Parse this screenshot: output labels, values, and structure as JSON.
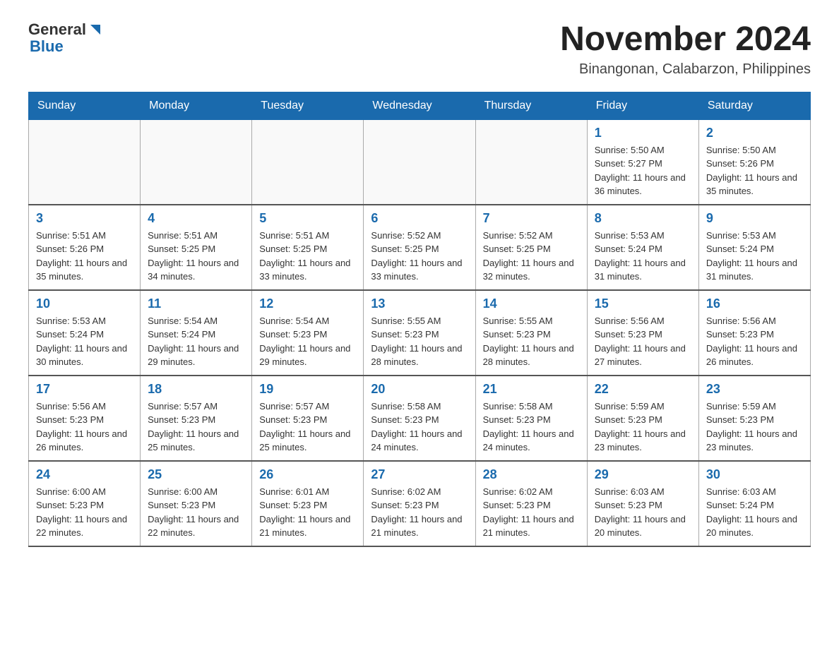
{
  "header": {
    "logo": {
      "general": "General",
      "blue": "Blue"
    },
    "title": "November 2024",
    "subtitle": "Binangonan, Calabarzon, Philippines"
  },
  "weekdays": [
    "Sunday",
    "Monday",
    "Tuesday",
    "Wednesday",
    "Thursday",
    "Friday",
    "Saturday"
  ],
  "weeks": [
    [
      {
        "day": "",
        "info": ""
      },
      {
        "day": "",
        "info": ""
      },
      {
        "day": "",
        "info": ""
      },
      {
        "day": "",
        "info": ""
      },
      {
        "day": "",
        "info": ""
      },
      {
        "day": "1",
        "info": "Sunrise: 5:50 AM\nSunset: 5:27 PM\nDaylight: 11 hours and 36 minutes."
      },
      {
        "day": "2",
        "info": "Sunrise: 5:50 AM\nSunset: 5:26 PM\nDaylight: 11 hours and 35 minutes."
      }
    ],
    [
      {
        "day": "3",
        "info": "Sunrise: 5:51 AM\nSunset: 5:26 PM\nDaylight: 11 hours and 35 minutes."
      },
      {
        "day": "4",
        "info": "Sunrise: 5:51 AM\nSunset: 5:25 PM\nDaylight: 11 hours and 34 minutes."
      },
      {
        "day": "5",
        "info": "Sunrise: 5:51 AM\nSunset: 5:25 PM\nDaylight: 11 hours and 33 minutes."
      },
      {
        "day": "6",
        "info": "Sunrise: 5:52 AM\nSunset: 5:25 PM\nDaylight: 11 hours and 33 minutes."
      },
      {
        "day": "7",
        "info": "Sunrise: 5:52 AM\nSunset: 5:25 PM\nDaylight: 11 hours and 32 minutes."
      },
      {
        "day": "8",
        "info": "Sunrise: 5:53 AM\nSunset: 5:24 PM\nDaylight: 11 hours and 31 minutes."
      },
      {
        "day": "9",
        "info": "Sunrise: 5:53 AM\nSunset: 5:24 PM\nDaylight: 11 hours and 31 minutes."
      }
    ],
    [
      {
        "day": "10",
        "info": "Sunrise: 5:53 AM\nSunset: 5:24 PM\nDaylight: 11 hours and 30 minutes."
      },
      {
        "day": "11",
        "info": "Sunrise: 5:54 AM\nSunset: 5:24 PM\nDaylight: 11 hours and 29 minutes."
      },
      {
        "day": "12",
        "info": "Sunrise: 5:54 AM\nSunset: 5:23 PM\nDaylight: 11 hours and 29 minutes."
      },
      {
        "day": "13",
        "info": "Sunrise: 5:55 AM\nSunset: 5:23 PM\nDaylight: 11 hours and 28 minutes."
      },
      {
        "day": "14",
        "info": "Sunrise: 5:55 AM\nSunset: 5:23 PM\nDaylight: 11 hours and 28 minutes."
      },
      {
        "day": "15",
        "info": "Sunrise: 5:56 AM\nSunset: 5:23 PM\nDaylight: 11 hours and 27 minutes."
      },
      {
        "day": "16",
        "info": "Sunrise: 5:56 AM\nSunset: 5:23 PM\nDaylight: 11 hours and 26 minutes."
      }
    ],
    [
      {
        "day": "17",
        "info": "Sunrise: 5:56 AM\nSunset: 5:23 PM\nDaylight: 11 hours and 26 minutes."
      },
      {
        "day": "18",
        "info": "Sunrise: 5:57 AM\nSunset: 5:23 PM\nDaylight: 11 hours and 25 minutes."
      },
      {
        "day": "19",
        "info": "Sunrise: 5:57 AM\nSunset: 5:23 PM\nDaylight: 11 hours and 25 minutes."
      },
      {
        "day": "20",
        "info": "Sunrise: 5:58 AM\nSunset: 5:23 PM\nDaylight: 11 hours and 24 minutes."
      },
      {
        "day": "21",
        "info": "Sunrise: 5:58 AM\nSunset: 5:23 PM\nDaylight: 11 hours and 24 minutes."
      },
      {
        "day": "22",
        "info": "Sunrise: 5:59 AM\nSunset: 5:23 PM\nDaylight: 11 hours and 23 minutes."
      },
      {
        "day": "23",
        "info": "Sunrise: 5:59 AM\nSunset: 5:23 PM\nDaylight: 11 hours and 23 minutes."
      }
    ],
    [
      {
        "day": "24",
        "info": "Sunrise: 6:00 AM\nSunset: 5:23 PM\nDaylight: 11 hours and 22 minutes."
      },
      {
        "day": "25",
        "info": "Sunrise: 6:00 AM\nSunset: 5:23 PM\nDaylight: 11 hours and 22 minutes."
      },
      {
        "day": "26",
        "info": "Sunrise: 6:01 AM\nSunset: 5:23 PM\nDaylight: 11 hours and 21 minutes."
      },
      {
        "day": "27",
        "info": "Sunrise: 6:02 AM\nSunset: 5:23 PM\nDaylight: 11 hours and 21 minutes."
      },
      {
        "day": "28",
        "info": "Sunrise: 6:02 AM\nSunset: 5:23 PM\nDaylight: 11 hours and 21 minutes."
      },
      {
        "day": "29",
        "info": "Sunrise: 6:03 AM\nSunset: 5:23 PM\nDaylight: 11 hours and 20 minutes."
      },
      {
        "day": "30",
        "info": "Sunrise: 6:03 AM\nSunset: 5:24 PM\nDaylight: 11 hours and 20 minutes."
      }
    ]
  ]
}
